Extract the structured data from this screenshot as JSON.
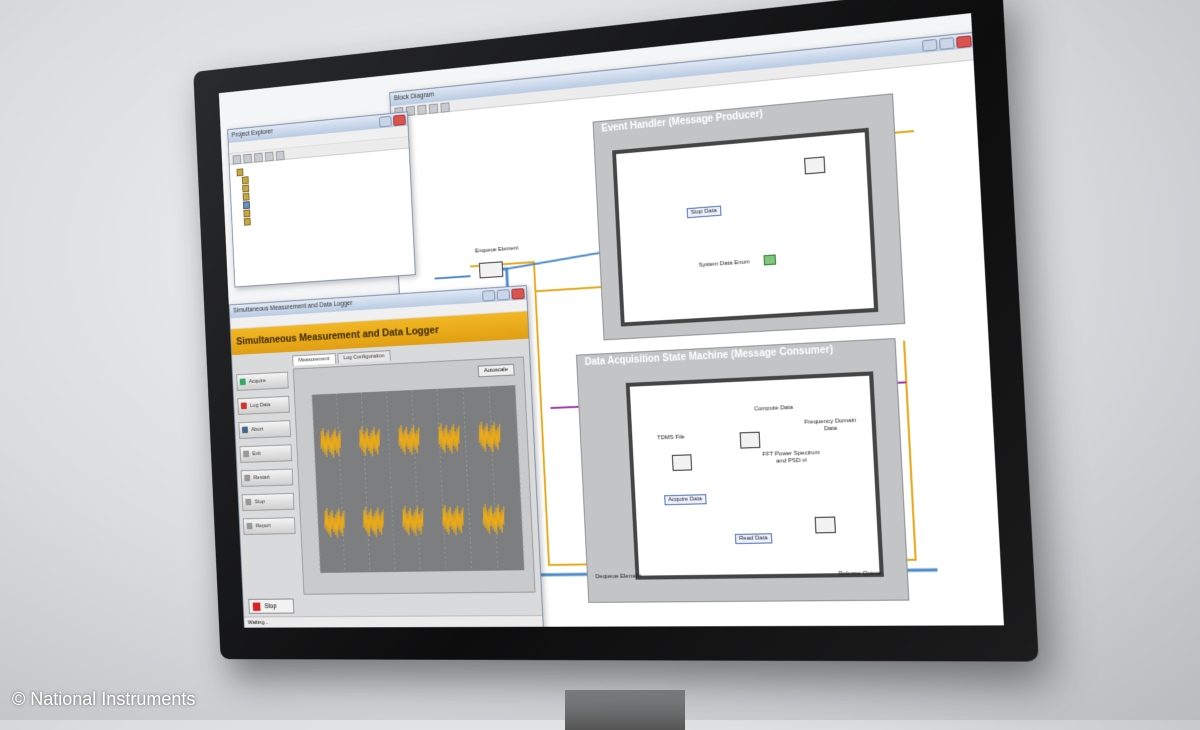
{
  "credit": "© National Instruments",
  "project_explorer": {
    "title": "Project Explorer"
  },
  "diagram": {
    "title": "Block Diagram",
    "frame1_title": "Event Handler (Message Producer)",
    "frame2_title": "Data Acquisition State Machine (Message Consumer)",
    "labels": {
      "enqueue_element": "Enqueue Element",
      "dequeue_element": "Dequeue Element",
      "release_queue": "Release Queue",
      "acquire_data": "Acquire Data",
      "compute_data": "Compute Data",
      "tdms_file": "TDMS File",
      "fft_power_spectrum": "FFT Power Spectrum and PSD.vi",
      "frequency_domain_data": "Frequency Domain Data",
      "stop_data": "Stop Data",
      "read_data": "Read Data",
      "system_data_enum": "System Data Enum"
    }
  },
  "front_panel": {
    "title": "Simultaneous Measurement and Data Logger",
    "banner": "Simultaneous Measurement and Data Logger",
    "tabs": [
      "Measurement",
      "Log Configuration"
    ],
    "side_buttons": [
      "Acquire",
      "Log Data",
      "Abort",
      "Exit",
      "Restart",
      "Stop",
      "Report"
    ],
    "autoscale": "Autoscale",
    "stop": "Stop",
    "status": "Waiting..."
  },
  "colors": {
    "banner": "#e8a91a",
    "wire_orange": "#e8a91a",
    "wire_blue": "#4a8ac8",
    "wire_purple": "#a33fa8",
    "wire_red": "#c8281e"
  }
}
